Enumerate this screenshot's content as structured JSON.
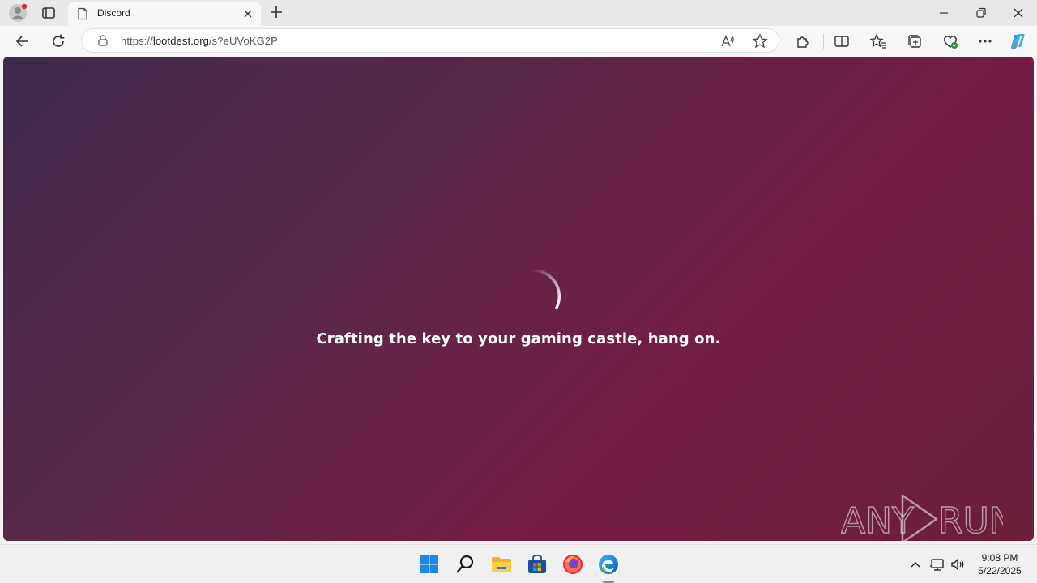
{
  "browser": {
    "tab": {
      "title": "Discord",
      "icon": "page-icon"
    },
    "address": {
      "url_prefix": "https://",
      "url_host": "lootdest.org",
      "url_rest": "/s?eUVoKG2P"
    }
  },
  "page": {
    "loading_message": "Crafting the key to your gaming castle, hang on.",
    "background_colors": [
      "#3e2a4c",
      "#741d45",
      "#6b1f3a"
    ]
  },
  "watermark": {
    "text": "ANY RUN"
  },
  "taskbar": {
    "apps": [
      "start-icon",
      "search-icon",
      "file-explorer-icon",
      "store-icon",
      "firefox-icon",
      "edge-icon"
    ],
    "clock": {
      "time": "9:08 PM",
      "date": "5/22/2025"
    }
  }
}
